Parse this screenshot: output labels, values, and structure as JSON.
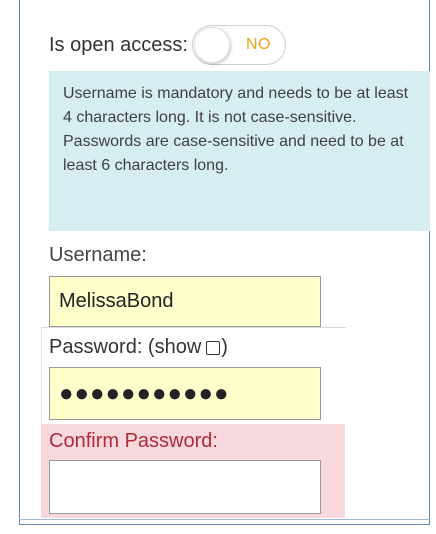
{
  "open_access": {
    "label": "Is open access:",
    "toggle_state": "NO"
  },
  "info_text": "Username is mandatory and needs to be at least 4 characters long. It is not case-sensitive. Passwords are case-sensitive and need to be at least 6 characters long.",
  "username": {
    "label": "Username:",
    "value": "MelissaBond"
  },
  "password": {
    "label": "Password: (show",
    "label_close": ")",
    "value_masked": "●●●●●●●●●●●"
  },
  "confirm_password": {
    "label": "Confirm Password:",
    "value": ""
  },
  "colors": {
    "toggle_text": "#f0a019",
    "info_bg": "#d6edf1",
    "field_bg": "#ffffcc",
    "error_bg": "#f7d9dd",
    "error_text": "#b02a37",
    "frame_border": "#5b88c2"
  }
}
